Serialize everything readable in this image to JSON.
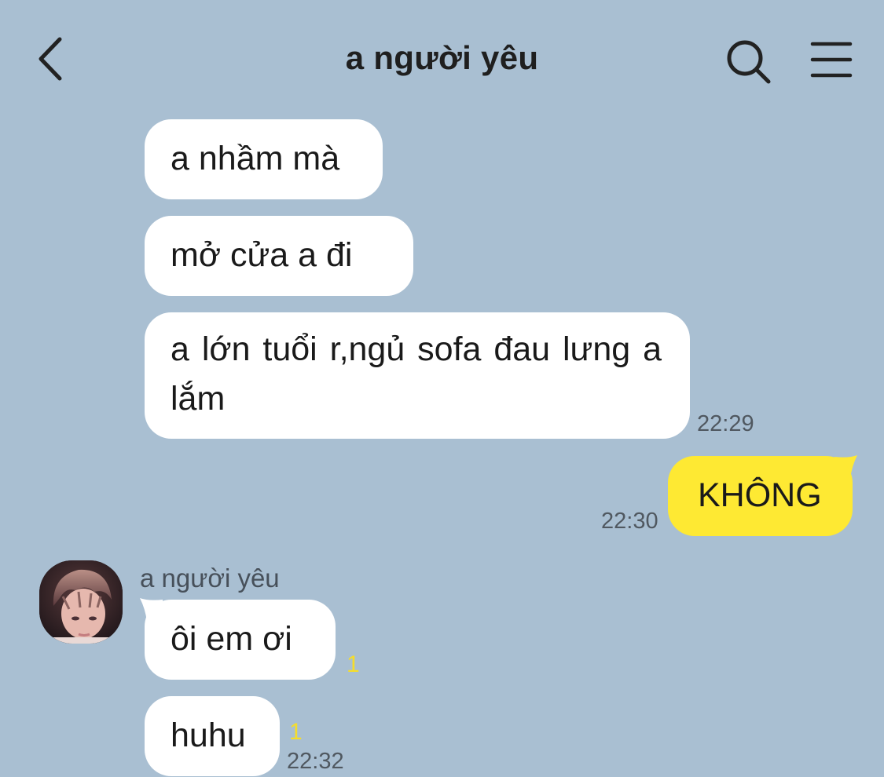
{
  "header": {
    "title": "a người yêu",
    "back_icon": "chevron-left-icon",
    "search_icon": "search-icon",
    "menu_icon": "hamburger-menu-icon"
  },
  "messages": [
    {
      "text": "a nhầm mà"
    },
    {
      "text": "mở cửa a đi"
    },
    {
      "text": "a lớn tuổi r,ngủ sofa đau lưng a lắm",
      "time": "22:29"
    },
    {
      "text": "KHÔNG",
      "time": "22:30"
    },
    {
      "sender": "a người yêu",
      "text": "ôi em ơi",
      "unread": "1"
    },
    {
      "text": "huhu",
      "unread": "1",
      "time": "22:32"
    }
  ],
  "colors": {
    "background": "#a9bfd2",
    "incoming_bubble": "#ffffff",
    "outgoing_bubble": "#fee933",
    "unread_count": "#f5dd2b"
  }
}
